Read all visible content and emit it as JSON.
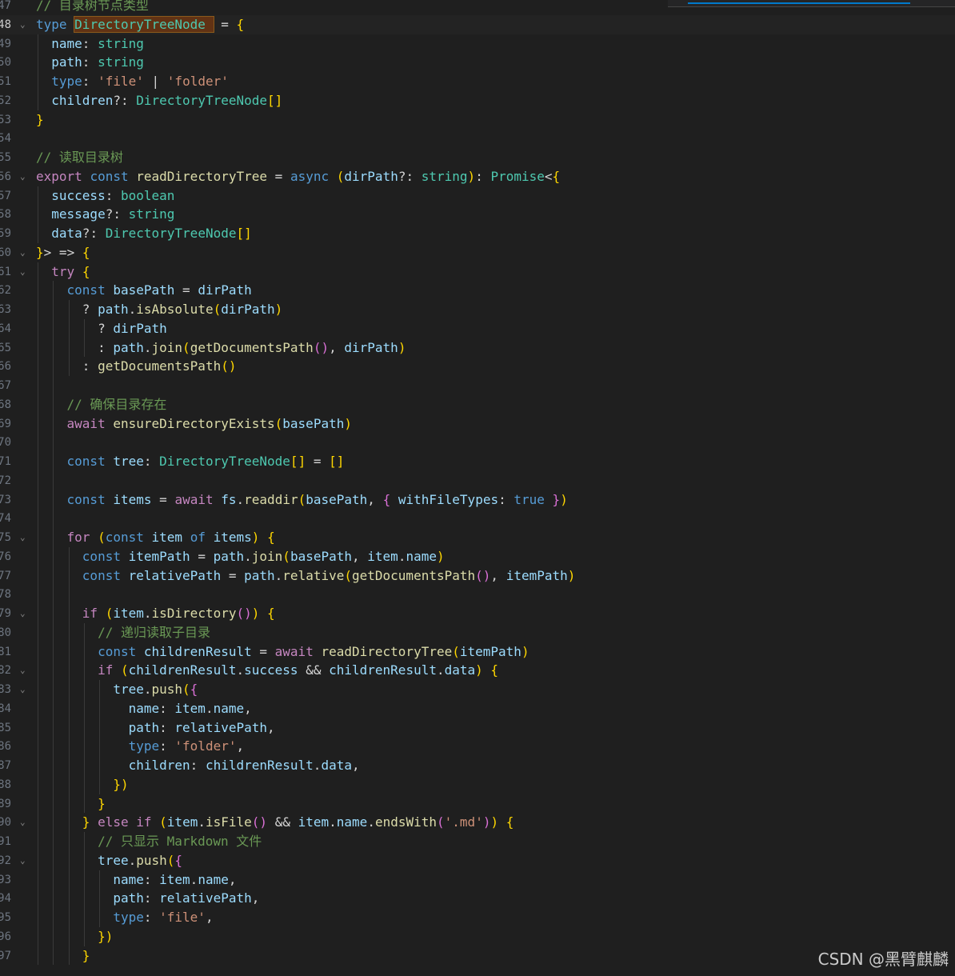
{
  "editor": {
    "language": "typescript",
    "current_line": 48,
    "lines": [
      {
        "n": "47",
        "text": "// 目录树节点类型"
      },
      {
        "n": "48",
        "text": "type DirectoryTreeNode = {"
      },
      {
        "n": "49",
        "text": "  name: string"
      },
      {
        "n": "50",
        "text": "  path: string"
      },
      {
        "n": "51",
        "text": "  type: 'file' | 'folder'"
      },
      {
        "n": "52",
        "text": "  children?: DirectoryTreeNode[]"
      },
      {
        "n": "53",
        "text": "}"
      },
      {
        "n": "54",
        "text": ""
      },
      {
        "n": "55",
        "text": "// 读取目录树"
      },
      {
        "n": "56",
        "text": "export const readDirectoryTree = async (dirPath?: string): Promise<{"
      },
      {
        "n": "57",
        "text": "  success: boolean"
      },
      {
        "n": "58",
        "text": "  message?: string"
      },
      {
        "n": "59",
        "text": "  data?: DirectoryTreeNode[]"
      },
      {
        "n": "60",
        "text": "}> => {"
      },
      {
        "n": "61",
        "text": "  try {"
      },
      {
        "n": "62",
        "text": "    const basePath = dirPath"
      },
      {
        "n": "63",
        "text": "      ? path.isAbsolute(dirPath)"
      },
      {
        "n": "64",
        "text": "        ? dirPath"
      },
      {
        "n": "65",
        "text": "        : path.join(getDocumentsPath(), dirPath)"
      },
      {
        "n": "66",
        "text": "      : getDocumentsPath()"
      },
      {
        "n": "67",
        "text": ""
      },
      {
        "n": "68",
        "text": "    // 确保目录存在"
      },
      {
        "n": "69",
        "text": "    await ensureDirectoryExists(basePath)"
      },
      {
        "n": "70",
        "text": ""
      },
      {
        "n": "71",
        "text": "    const tree: DirectoryTreeNode[] = []"
      },
      {
        "n": "72",
        "text": ""
      },
      {
        "n": "73",
        "text": "    const items = await fs.readdir(basePath, { withFileTypes: true })"
      },
      {
        "n": "74",
        "text": ""
      },
      {
        "n": "75",
        "text": "    for (const item of items) {"
      },
      {
        "n": "76",
        "text": "      const itemPath = path.join(basePath, item.name)"
      },
      {
        "n": "77",
        "text": "      const relativePath = path.relative(getDocumentsPath(), itemPath)"
      },
      {
        "n": "78",
        "text": ""
      },
      {
        "n": "79",
        "text": "      if (item.isDirectory()) {"
      },
      {
        "n": "80",
        "text": "        // 递归读取子目录"
      },
      {
        "n": "81",
        "text": "        const childrenResult = await readDirectoryTree(itemPath)"
      },
      {
        "n": "82",
        "text": "        if (childrenResult.success && childrenResult.data) {"
      },
      {
        "n": "83",
        "text": "          tree.push({"
      },
      {
        "n": "84",
        "text": "            name: item.name,"
      },
      {
        "n": "85",
        "text": "            path: relativePath,"
      },
      {
        "n": "86",
        "text": "            type: 'folder',"
      },
      {
        "n": "87",
        "text": "            children: childrenResult.data,"
      },
      {
        "n": "88",
        "text": "          })"
      },
      {
        "n": "89",
        "text": "        }"
      },
      {
        "n": "90",
        "text": "      } else if (item.isFile() && item.name.endsWith('.md')) {"
      },
      {
        "n": "91",
        "text": "        // 只显示 Markdown 文件"
      },
      {
        "n": "92",
        "text": "        tree.push({"
      },
      {
        "n": "93",
        "text": "          name: item.name,"
      },
      {
        "n": "94",
        "text": "          path: relativePath,"
      },
      {
        "n": "95",
        "text": "          type: 'file',"
      },
      {
        "n": "96",
        "text": "        })"
      },
      {
        "n": "97",
        "text": "      }"
      }
    ]
  },
  "watermark": "CSDN @黑臂麒麟",
  "colors": {
    "background": "#1f1f1f",
    "comment": "#6a9955",
    "keyword": "#569cd6",
    "control": "#c586c0",
    "function": "#dcdcaa",
    "variable": "#9cdcfe",
    "type": "#4ec9b0",
    "string": "#ce9178",
    "find_accent": "#007acc"
  }
}
